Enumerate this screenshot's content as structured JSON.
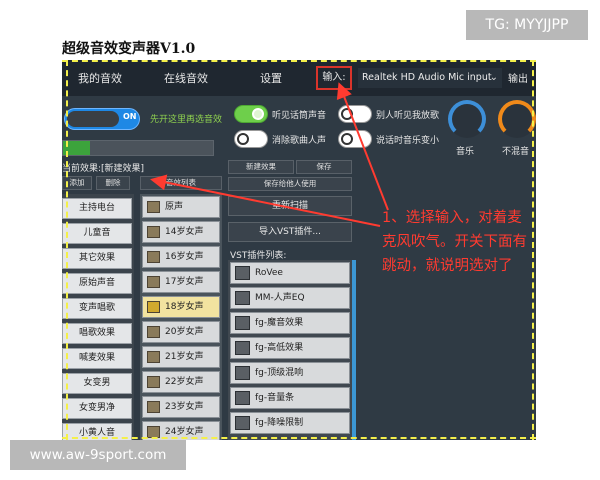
{
  "watermark_top": "TG: MYYJJPP",
  "watermark_bottom": "www.aw-9sport.com",
  "app": {
    "title": "超级音效变声器V1.0"
  },
  "menu": {
    "my_effects": "我的音效",
    "online_effects": "在线音效",
    "settings": "设置",
    "input_label": "输入:",
    "input_device": "Realtek HD Audio Mic input",
    "output_label": "输出"
  },
  "controls": {
    "main_toggle_state": "ON",
    "main_toggle_hint": "先开这里再选音效",
    "switches": [
      {
        "label": "听见话筒声音",
        "on": true
      },
      {
        "label": "别人听见我放歌",
        "on": false
      },
      {
        "label": "消除歌曲人声",
        "on": false
      },
      {
        "label": "说话时音乐变小",
        "on": false
      }
    ],
    "gauges": [
      {
        "label": "音乐",
        "color": "#3d8fd8"
      },
      {
        "label": "不混音",
        "color": "#f08a1a"
      }
    ],
    "level_fraction": 0.18
  },
  "effects": {
    "current_label": "当前效果:[新建效果]",
    "add": "添加",
    "delete": "删除",
    "sort": "音效列表",
    "categories": [
      "主持电台",
      "儿童音",
      "其它效果",
      "原始声音",
      "变声唱歌",
      "唱歌效果",
      "喊麦效果",
      "女变男",
      "女变男净",
      "小黄人音"
    ],
    "voices": [
      {
        "name": "原声",
        "selected": false
      },
      {
        "name": "14岁女声",
        "selected": false
      },
      {
        "name": "16岁女声",
        "selected": false
      },
      {
        "name": "17岁女声",
        "selected": false
      },
      {
        "name": "18岁女声",
        "selected": true
      },
      {
        "name": "20岁女声",
        "selected": false
      },
      {
        "name": "21岁女声",
        "selected": false
      },
      {
        "name": "22岁女声",
        "selected": false
      },
      {
        "name": "23岁女声",
        "selected": false
      },
      {
        "name": "24岁女声",
        "selected": false
      }
    ]
  },
  "vst": {
    "new_effect": "新建效果",
    "save": "保存",
    "save_for_others": "保存给他人使用",
    "rescan": "重新扫描",
    "import": "导入VST插件...",
    "list_label": "VST插件列表:",
    "plugins": [
      "RoVee",
      "MM-人声EQ",
      "fg-魔音效果",
      "fg-高低效果",
      "fg-顶级混响",
      "fg-音量条",
      "fg-降噪限制"
    ]
  },
  "annotation": {
    "text": "1、选择输入，对着麦克风吹气。开关下面有跳动，就说明选对了",
    "color": "#ff3b30"
  },
  "colors": {
    "window_bg": "#2f3a44",
    "highlight_yellow": "#f4f04a",
    "accent_blue": "#1e88e5",
    "active_green": "#6ecf4b"
  }
}
